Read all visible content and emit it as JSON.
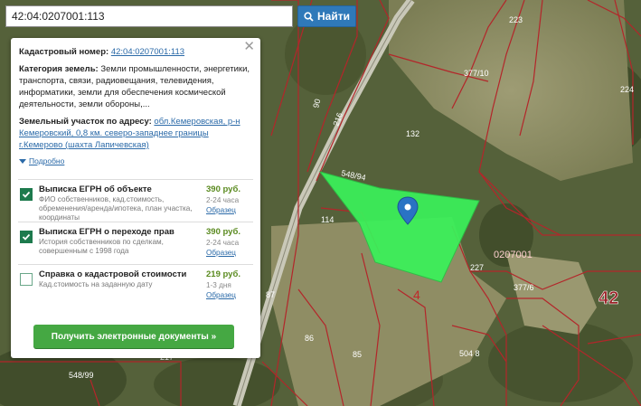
{
  "search": {
    "value": "42:04:0207001:113",
    "button_label": "Найти"
  },
  "panel": {
    "close_label": "✕",
    "cadastral_label": "Кадастровый номер:",
    "cadastral_value": "42:04:0207001:113",
    "category_label": "Категория земель:",
    "category_value": "Земли промышленности, энергетики, транспорта, связи, радиовещания, телевидения, информатики, земли для обеспечения космической деятельности, земли обороны,...",
    "address_label": "Земельный участок по адресу:",
    "address_value": "обл.Кемеровская, р-н Кемеровский, 0,8 км. северо-западнее границы г.Кемерово (шахта Лапичевская)",
    "details_label": "Подробно",
    "services": [
      {
        "title": "Выписка ЕГРН об объекте",
        "desc": "ФИО собственников, кад.стоимость, обременения/аренда/ипотека, план участка, координаты",
        "price": "390 руб.",
        "time": "2-24 часа",
        "sample": "Образец",
        "checked": true
      },
      {
        "title": "Выписка ЕГРН о переходе прав",
        "desc": "История собственников по сделкам, совершенным с 1998 года",
        "price": "390 руб.",
        "time": "2-24 часа",
        "sample": "Образец",
        "checked": true
      },
      {
        "title": "Справка о кадастровой стоимости",
        "desc": "Кад.стоимость на заданную дату",
        "price": "219 руб.",
        "time": "1-3 дня",
        "sample": "Образец",
        "checked": false
      }
    ],
    "cta_label": "Получить электронные документы »"
  },
  "map": {
    "parcel_labels": [
      "223",
      "377/10",
      "224",
      "132",
      "548/94",
      "114",
      "0207001",
      "227",
      "377/6",
      "42",
      "87",
      "86",
      "85",
      "217",
      "504 8",
      "548/99",
      "4",
      "90",
      "216"
    ],
    "colors": {
      "parcel_fill": "#3af25a",
      "boundary": "#b3262a",
      "marker": "#2a73c4"
    }
  }
}
